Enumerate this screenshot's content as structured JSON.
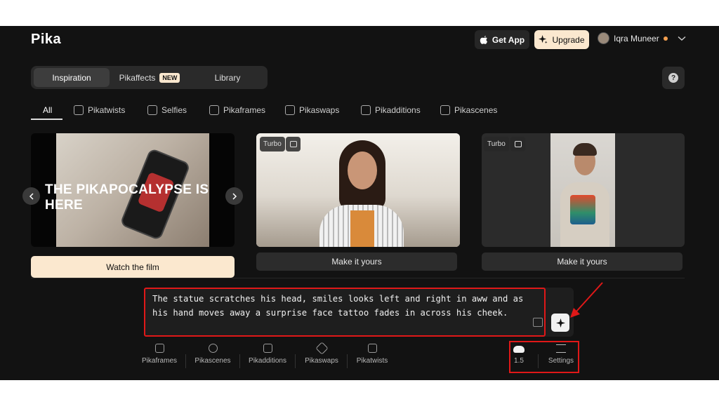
{
  "header": {
    "logo": "Pika",
    "get_app": "Get App",
    "upgrade": "Upgrade",
    "user_name": "Iqra Muneer"
  },
  "tabs": [
    {
      "label": "Inspiration",
      "active": true
    },
    {
      "label": "Pikaffects",
      "badge": "NEW"
    },
    {
      "label": "Library"
    }
  ],
  "help": "?",
  "categories": [
    {
      "label": "All",
      "active": true
    },
    {
      "label": "Pikatwists"
    },
    {
      "label": "Selfies"
    },
    {
      "label": "Pikaframes"
    },
    {
      "label": "Pikaswaps"
    },
    {
      "label": "Pikadditions"
    },
    {
      "label": "Pikascenes"
    }
  ],
  "cards": [
    {
      "hero_text": "THE PIKAPOCALYPSE IS HERE",
      "cta": "Watch the film"
    },
    {
      "tag": "Turbo",
      "cta": "Make it yours"
    },
    {
      "tag": "Turbo",
      "cta": "Make it yours"
    }
  ],
  "prompt": {
    "text": "The statue scratches his head, smiles looks left and right in aww and as his hand moves away a surprise face tattoo fades in across his cheek."
  },
  "toolbar": [
    {
      "label": "Pikaframes"
    },
    {
      "label": "Pikascenes"
    },
    {
      "label": "Pikadditions"
    },
    {
      "label": "Pikaswaps"
    },
    {
      "label": "Pikatwists"
    }
  ],
  "model": {
    "version": "1.5"
  },
  "settings_label": "Settings",
  "colors": {
    "background": "#121212",
    "accent": "#fbe8cf",
    "annotation": "#e01818"
  }
}
